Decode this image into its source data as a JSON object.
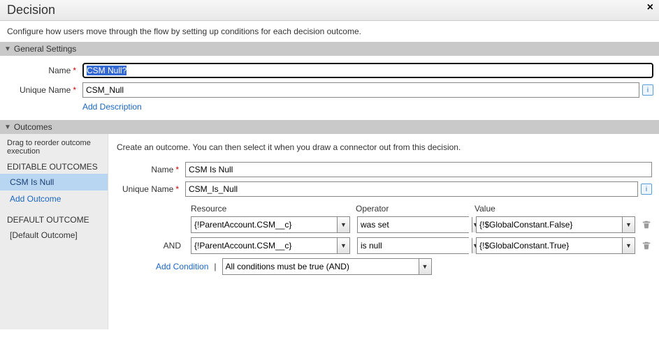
{
  "header": {
    "title": "Decision",
    "close_tooltip": "Close"
  },
  "description": "Configure how users move through the flow by setting up conditions for each decision outcome.",
  "general": {
    "section_label": "General Settings",
    "name_label": "Name",
    "name_value": "CSM Null?",
    "unique_label": "Unique Name",
    "unique_value": "CSM_Null",
    "add_description": "Add Description",
    "info_tooltip": "Info"
  },
  "outcomes": {
    "section_label": "Outcomes",
    "drag_hint": "Drag to reorder outcome execution",
    "editable_heading": "EDITABLE OUTCOMES",
    "items": [
      {
        "label": "CSM Is Null",
        "selected": true
      }
    ],
    "add_outcome": "Add Outcome",
    "default_heading": "DEFAULT OUTCOME",
    "default_label": "[Default Outcome]"
  },
  "outcome_detail": {
    "create_hint": "Create an outcome.  You can then select it when you draw a connector out from this decision.",
    "name_label": "Name",
    "name_value": "CSM Is Null",
    "unique_label": "Unique Name",
    "unique_value": "CSM_Is_Null",
    "headers": {
      "resource": "Resource",
      "operator": "Operator",
      "value": "Value"
    },
    "and_label": "AND",
    "conditions": [
      {
        "resource": "{!ParentAccount.CSM__c}",
        "operator": "was set",
        "value": "{!$GlobalConstant.False}"
      },
      {
        "resource": "{!ParentAccount.CSM__c}",
        "operator": "is null",
        "value": "{!$GlobalConstant.True}"
      }
    ],
    "add_condition": "Add Condition",
    "logic_value": "All conditions must be true (AND)"
  }
}
